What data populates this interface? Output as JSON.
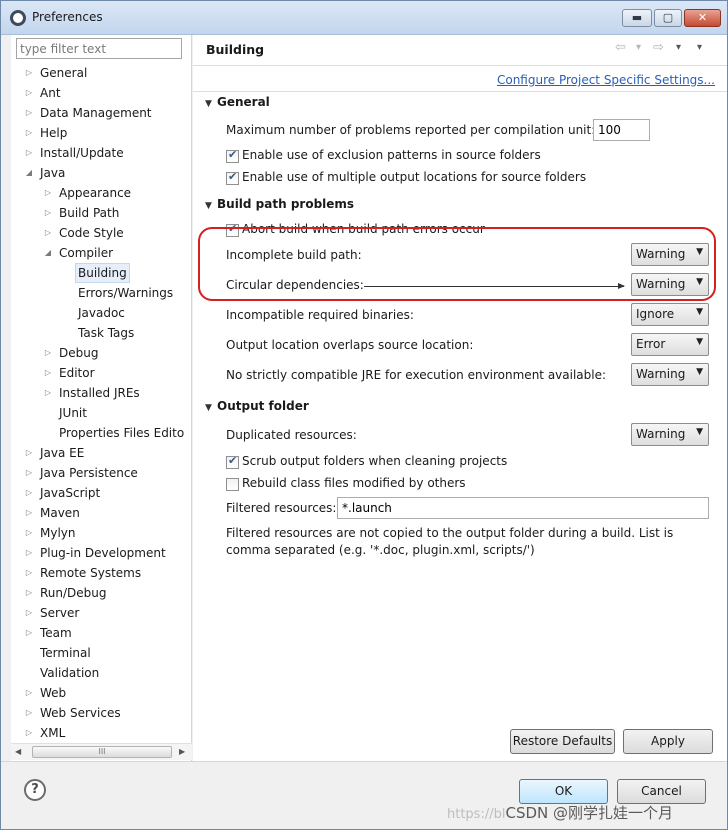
{
  "window": {
    "title": "Preferences",
    "app_icon": "eclipse-icon",
    "min": "▬",
    "max": "▢",
    "close": "✕"
  },
  "filter": {
    "placeholder": "type filter text"
  },
  "tree": {
    "items": [
      {
        "label": "General",
        "twisty": "▷"
      },
      {
        "label": "Ant",
        "twisty": "▷"
      },
      {
        "label": "Data Management",
        "twisty": "▷"
      },
      {
        "label": "Help",
        "twisty": "▷"
      },
      {
        "label": "Install/Update",
        "twisty": "▷"
      },
      {
        "label": "Java",
        "twisty": "◢"
      },
      {
        "label": "Appearance",
        "twisty": "▷"
      },
      {
        "label": "Build Path",
        "twisty": "▷"
      },
      {
        "label": "Code Style",
        "twisty": "▷"
      },
      {
        "label": "Compiler",
        "twisty": "◢"
      },
      {
        "label": "Building",
        "twisty": ""
      },
      {
        "label": "Errors/Warnings",
        "twisty": ""
      },
      {
        "label": "Javadoc",
        "twisty": ""
      },
      {
        "label": "Task Tags",
        "twisty": ""
      },
      {
        "label": "Debug",
        "twisty": "▷"
      },
      {
        "label": "Editor",
        "twisty": "▷"
      },
      {
        "label": "Installed JREs",
        "twisty": "▷"
      },
      {
        "label": "JUnit",
        "twisty": ""
      },
      {
        "label": "Properties Files Edito",
        "twisty": ""
      },
      {
        "label": "Java EE",
        "twisty": "▷"
      },
      {
        "label": "Java Persistence",
        "twisty": "▷"
      },
      {
        "label": "JavaScript",
        "twisty": "▷"
      },
      {
        "label": "Maven",
        "twisty": "▷"
      },
      {
        "label": "Mylyn",
        "twisty": "▷"
      },
      {
        "label": "Plug-in Development",
        "twisty": "▷"
      },
      {
        "label": "Remote Systems",
        "twisty": "▷"
      },
      {
        "label": "Run/Debug",
        "twisty": "▷"
      },
      {
        "label": "Server",
        "twisty": "▷"
      },
      {
        "label": "Team",
        "twisty": "▷"
      },
      {
        "label": "Terminal",
        "twisty": ""
      },
      {
        "label": "Validation",
        "twisty": ""
      },
      {
        "label": "Web",
        "twisty": "▷"
      },
      {
        "label": "Web Services",
        "twisty": "▷"
      },
      {
        "label": "XML",
        "twisty": "▷"
      }
    ],
    "selected": "Building",
    "scroll_left": "◀",
    "scroll_right": "▶",
    "scroll_grip": "III"
  },
  "page": {
    "title": "Building",
    "nav_back": "⇦",
    "nav_back_menu": "▾",
    "nav_forward": "⇨",
    "nav_forward_menu": "▾",
    "view_menu": "▾",
    "config_link": "Configure Project Specific Settings..."
  },
  "general": {
    "header": "General",
    "max_problems_label": "Maximum number of problems reported per compilation unit:",
    "max_problems_value": "100",
    "exclusion_patterns": {
      "label": "Enable use of exclusion patterns in source folders",
      "checked": true
    },
    "multiple_output": {
      "label": "Enable use of multiple output locations for source folders",
      "checked": true
    }
  },
  "build_path": {
    "header": "Build path problems",
    "abort_build": {
      "label": "Abort build when build path errors occur",
      "checked": true
    },
    "incomplete_label": "Incomplete build path:",
    "incomplete_value": "Warning",
    "circular_label": "Circular dependencies:",
    "circular_value": "Warning",
    "incompatible_label": "Incompatible required binaries:",
    "incompatible_value": "Ignore",
    "overlap_label": "Output location overlaps source location:",
    "overlap_value": "Error",
    "jre_label": "No strictly compatible JRE for execution environment available:",
    "jre_value": "Warning"
  },
  "output_folder": {
    "header": "Output folder",
    "duplicated_label": "Duplicated resources:",
    "duplicated_value": "Warning",
    "scrub": {
      "label": "Scrub output folders when cleaning projects",
      "checked": true
    },
    "rebuild": {
      "label": "Rebuild class files modified by others",
      "checked": false
    },
    "filtered_label": "Filtered resources:",
    "filtered_value": "*.launch",
    "note_line1": "Filtered resources are not copied to the output folder during a build. List is",
    "note_line2": "comma separated (e.g. '*.doc, plugin.xml, scripts/')"
  },
  "buttons": {
    "restore": "Restore Defaults",
    "apply": "Apply",
    "ok": "OK",
    "cancel": "Cancel",
    "help": "?"
  },
  "watermark": {
    "prefix": "https://bl",
    "text": "CSDN @刚学扎娃一个月"
  },
  "colors": {
    "accent_link": "#2a5fb5",
    "highlight": "#d32020"
  }
}
